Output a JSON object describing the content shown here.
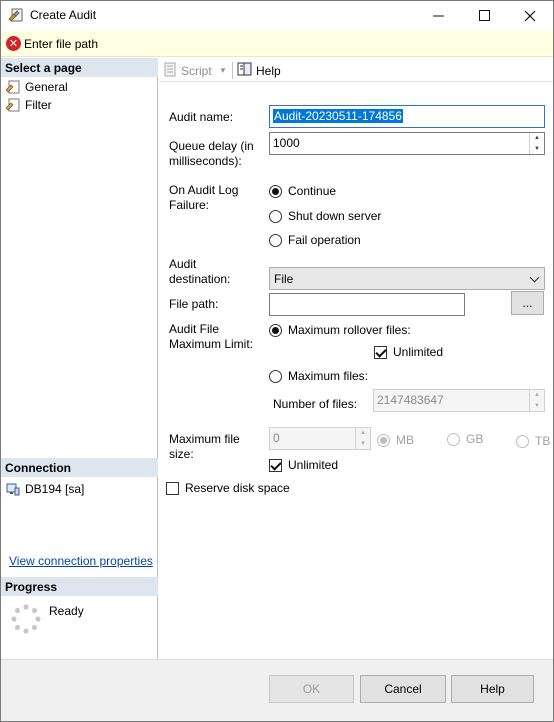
{
  "window": {
    "title": "Create Audit",
    "minimize_label": "—",
    "maximize_label": "☐",
    "close_label": "✕"
  },
  "error_bar": {
    "message": "Enter file path",
    "icon": "error-x-icon"
  },
  "left_pane": {
    "select_page_header": "Select a page",
    "pages": [
      {
        "label": "General",
        "icon": "wrench-page-icon"
      },
      {
        "label": "Filter",
        "icon": "wrench-page-icon"
      }
    ],
    "connection_header": "Connection",
    "connection_item": "DB194 [sa]",
    "connection_link": "View connection properties",
    "progress_header": "Progress",
    "progress_status": "Ready"
  },
  "toolbar": {
    "script_label": "Script",
    "script_dropdown": "▾",
    "help_label": "Help"
  },
  "form": {
    "audit_name_label": "Audit name:",
    "audit_name_value": "Audit-20230511-174856",
    "queue_delay_label": "Queue delay (in milliseconds):",
    "queue_delay_value": "1000",
    "on_failure_label": "On Audit Log Failure:",
    "on_failure_options": [
      "Continue",
      "Shut down server",
      "Fail operation"
    ],
    "on_failure_selected": 0,
    "destination_label": "Audit destination:",
    "destination_value": "File",
    "file_path_label": "File path:",
    "file_path_value": "",
    "browse_label": "...",
    "max_limit_label": "Audit File Maximum Limit:",
    "max_rollover_label": "Maximum rollover files:",
    "rollover_unlimited_label": "Unlimited",
    "rollover_unlimited_checked": true,
    "max_files_label": "Maximum files:",
    "number_of_files_label": "Number of files:",
    "number_of_files_value": "2147483647",
    "max_file_size_label": "Maximum file size:",
    "max_file_size_value": "0",
    "size_units": [
      "MB",
      "GB",
      "TB"
    ],
    "size_unit_selected": 0,
    "size_unlimited_label": "Unlimited",
    "size_unlimited_checked": true,
    "reserve_disk_label": "Reserve disk space",
    "reserve_disk_checked": false
  },
  "footer": {
    "ok_label": "OK",
    "cancel_label": "Cancel",
    "help_label": "Help"
  }
}
